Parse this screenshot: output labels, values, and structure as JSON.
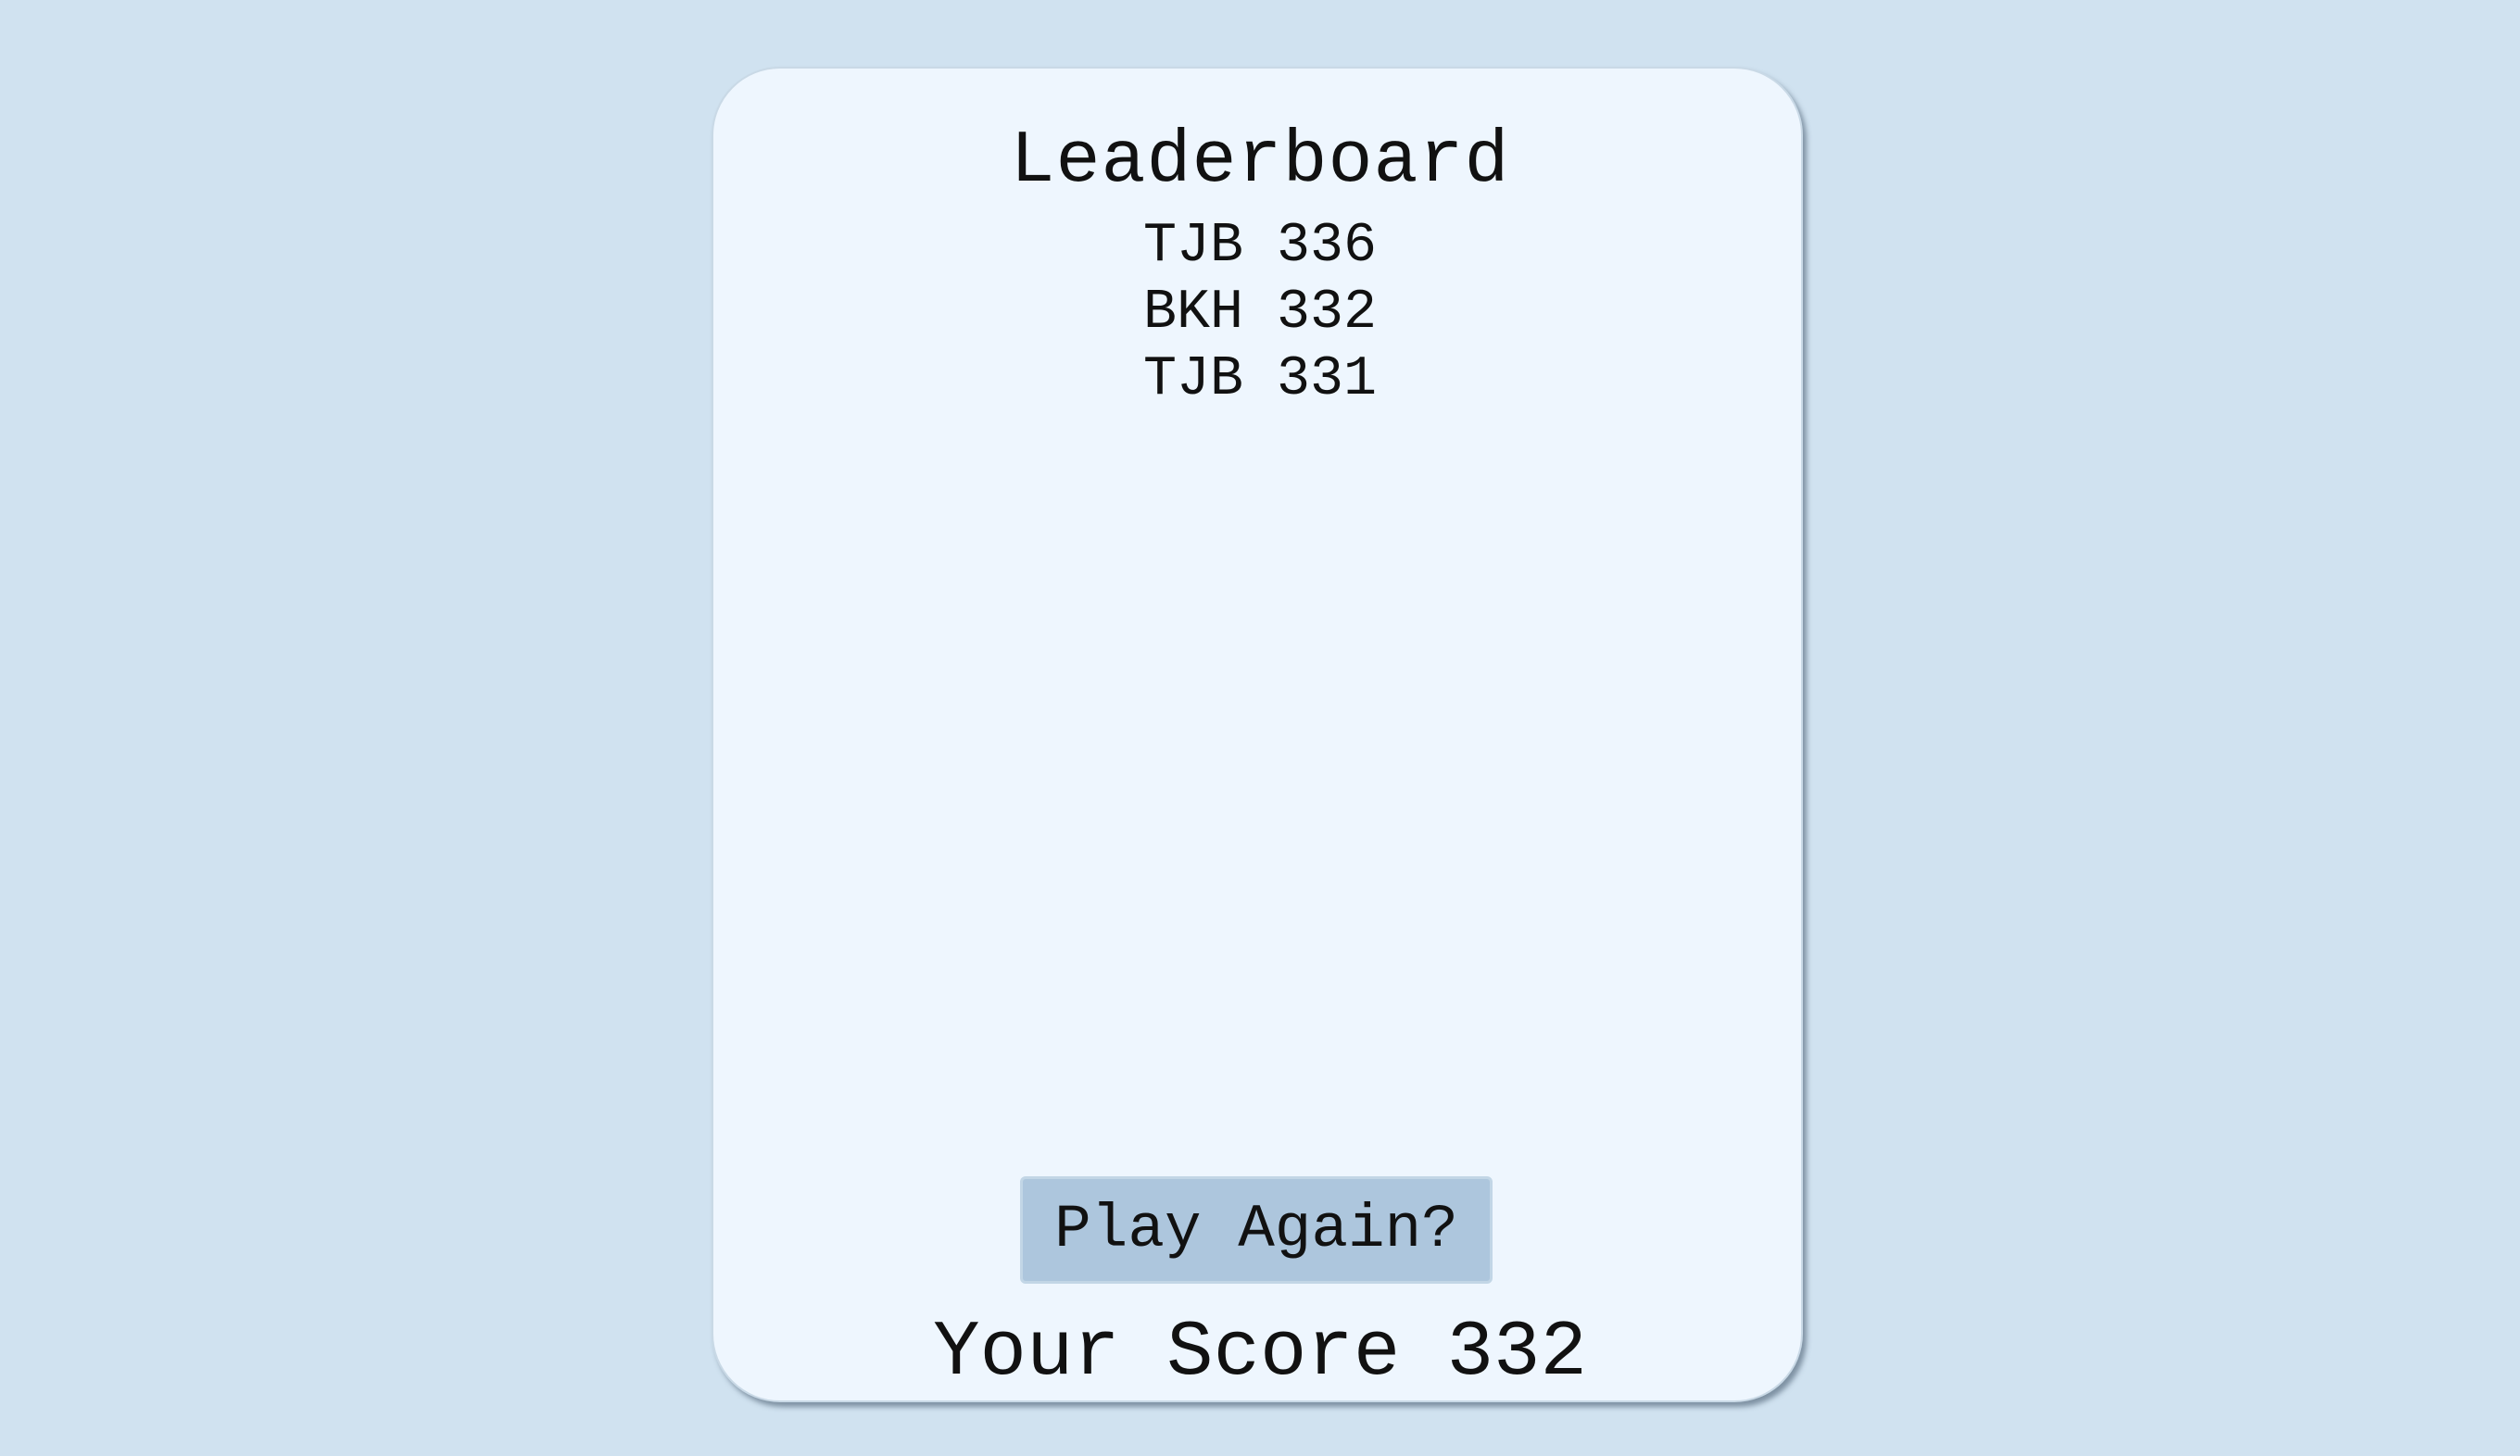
{
  "leaderboard": {
    "title": "Leaderboard",
    "entries": [
      {
        "name": "TJB",
        "score": "336",
        "text": "TJB 336"
      },
      {
        "name": "BKH",
        "score": "332",
        "text": "BKH 332"
      },
      {
        "name": "TJB",
        "score": "331",
        "text": "TJB 331"
      }
    ]
  },
  "actions": {
    "play_again_label": "Play Again?"
  },
  "footer": {
    "your_score_text": "Your Score 332"
  },
  "colors": {
    "background": "#d0e2f0",
    "card": "#eef6fe",
    "button": "#adc6dd",
    "text": "#111111"
  }
}
